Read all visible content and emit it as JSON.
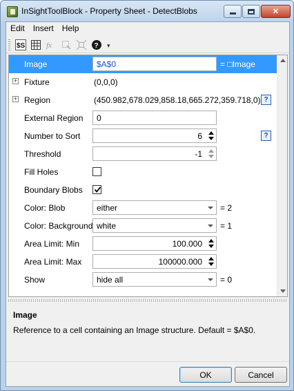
{
  "window": {
    "title": "InSightToolBlock - Property Sheet - DetectBlobs"
  },
  "menu": [
    "Edit",
    "Insert",
    "Help"
  ],
  "toolbar": {
    "icons": [
      "dollar-ref-icon",
      "grid-icon",
      "fx-icon",
      "select-region-icon",
      "fit-icon",
      "help-icon"
    ]
  },
  "properties": {
    "image": {
      "label": "Image",
      "value": "$A$0",
      "result": "= □Image"
    },
    "fixture": {
      "label": "Fixture",
      "value": "(0,0,0)"
    },
    "region": {
      "label": "Region",
      "value": "(450.982,678.029,858.18,665.272,359.718,0)",
      "help": "?"
    },
    "external_region": {
      "label": "External Region",
      "value": "0"
    },
    "number_to_sort": {
      "label": "Number to Sort",
      "value": "6",
      "help": "?"
    },
    "threshold": {
      "label": "Threshold",
      "value": "-1"
    },
    "fill_holes": {
      "label": "Fill Holes",
      "checked": false
    },
    "boundary_blobs": {
      "label": "Boundary Blobs",
      "checked": true
    },
    "color_blob": {
      "label": "Color: Blob",
      "value": "either",
      "result": "= 2"
    },
    "color_background": {
      "label": "Color: Background",
      "value": "white",
      "result": "= 1"
    },
    "area_limit_min": {
      "label": "Area Limit: Min",
      "value": "100.000"
    },
    "area_limit_max": {
      "label": "Area Limit: Max",
      "value": "100000.000"
    },
    "show": {
      "label": "Show",
      "value": "hide all",
      "result": "= 0"
    }
  },
  "description": {
    "title": "Image",
    "text": "Reference to a cell containing an Image structure. Default = $A$0."
  },
  "buttons": {
    "ok": "OK",
    "cancel": "Cancel"
  }
}
